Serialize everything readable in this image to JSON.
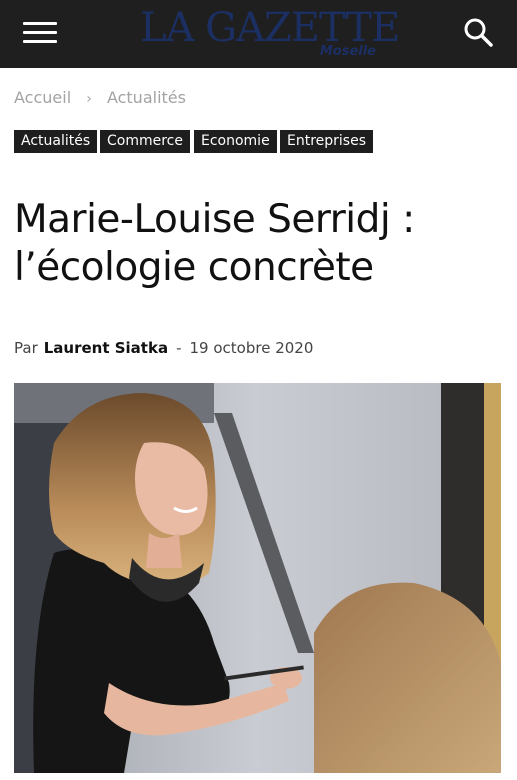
{
  "header": {
    "logo_main": "LA GAZETTE",
    "logo_sub": "Moselle",
    "menu_icon": "hamburger-menu-icon",
    "search_icon": "search-icon",
    "background_color": "#1f1f1f",
    "logo_color": "#1c2f63"
  },
  "breadcrumb": {
    "items": [
      "Accueil",
      "Actualités"
    ],
    "separator": "›"
  },
  "tags": [
    "Actualités",
    "Commerce",
    "Economie",
    "Entreprises"
  ],
  "article": {
    "title": "Marie-Louise Serridj : l’écologie concrète",
    "byline_prefix": "Par",
    "author": "Laurent Siatka",
    "separator": "-",
    "date": "19 octobre 2020"
  }
}
